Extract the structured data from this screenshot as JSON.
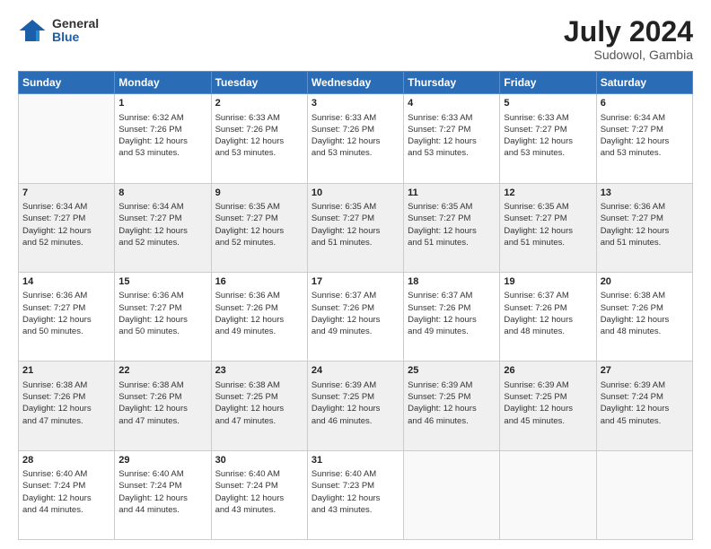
{
  "header": {
    "logo_general": "General",
    "logo_blue": "Blue",
    "month_year": "July 2024",
    "location": "Sudowol, Gambia"
  },
  "days_of_week": [
    "Sunday",
    "Monday",
    "Tuesday",
    "Wednesday",
    "Thursday",
    "Friday",
    "Saturday"
  ],
  "weeks": [
    [
      {
        "day": "",
        "content": ""
      },
      {
        "day": "1",
        "sunrise": "6:32 AM",
        "sunset": "7:26 PM",
        "daylight": "12 hours and 53 minutes."
      },
      {
        "day": "2",
        "sunrise": "6:33 AM",
        "sunset": "7:26 PM",
        "daylight": "12 hours and 53 minutes."
      },
      {
        "day": "3",
        "sunrise": "6:33 AM",
        "sunset": "7:26 PM",
        "daylight": "12 hours and 53 minutes."
      },
      {
        "day": "4",
        "sunrise": "6:33 AM",
        "sunset": "7:27 PM",
        "daylight": "12 hours and 53 minutes."
      },
      {
        "day": "5",
        "sunrise": "6:33 AM",
        "sunset": "7:27 PM",
        "daylight": "12 hours and 53 minutes."
      },
      {
        "day": "6",
        "sunrise": "6:34 AM",
        "sunset": "7:27 PM",
        "daylight": "12 hours and 53 minutes."
      }
    ],
    [
      {
        "day": "7",
        "sunrise": "6:34 AM",
        "sunset": "7:27 PM",
        "daylight": "12 hours and 52 minutes."
      },
      {
        "day": "8",
        "sunrise": "6:34 AM",
        "sunset": "7:27 PM",
        "daylight": "12 hours and 52 minutes."
      },
      {
        "day": "9",
        "sunrise": "6:35 AM",
        "sunset": "7:27 PM",
        "daylight": "12 hours and 52 minutes."
      },
      {
        "day": "10",
        "sunrise": "6:35 AM",
        "sunset": "7:27 PM",
        "daylight": "12 hours and 51 minutes."
      },
      {
        "day": "11",
        "sunrise": "6:35 AM",
        "sunset": "7:27 PM",
        "daylight": "12 hours and 51 minutes."
      },
      {
        "day": "12",
        "sunrise": "6:35 AM",
        "sunset": "7:27 PM",
        "daylight": "12 hours and 51 minutes."
      },
      {
        "day": "13",
        "sunrise": "6:36 AM",
        "sunset": "7:27 PM",
        "daylight": "12 hours and 51 minutes."
      }
    ],
    [
      {
        "day": "14",
        "sunrise": "6:36 AM",
        "sunset": "7:27 PM",
        "daylight": "12 hours and 50 minutes."
      },
      {
        "day": "15",
        "sunrise": "6:36 AM",
        "sunset": "7:27 PM",
        "daylight": "12 hours and 50 minutes."
      },
      {
        "day": "16",
        "sunrise": "6:36 AM",
        "sunset": "7:26 PM",
        "daylight": "12 hours and 49 minutes."
      },
      {
        "day": "17",
        "sunrise": "6:37 AM",
        "sunset": "7:26 PM",
        "daylight": "12 hours and 49 minutes."
      },
      {
        "day": "18",
        "sunrise": "6:37 AM",
        "sunset": "7:26 PM",
        "daylight": "12 hours and 49 minutes."
      },
      {
        "day": "19",
        "sunrise": "6:37 AM",
        "sunset": "7:26 PM",
        "daylight": "12 hours and 48 minutes."
      },
      {
        "day": "20",
        "sunrise": "6:38 AM",
        "sunset": "7:26 PM",
        "daylight": "12 hours and 48 minutes."
      }
    ],
    [
      {
        "day": "21",
        "sunrise": "6:38 AM",
        "sunset": "7:26 PM",
        "daylight": "12 hours and 47 minutes."
      },
      {
        "day": "22",
        "sunrise": "6:38 AM",
        "sunset": "7:26 PM",
        "daylight": "12 hours and 47 minutes."
      },
      {
        "day": "23",
        "sunrise": "6:38 AM",
        "sunset": "7:25 PM",
        "daylight": "12 hours and 47 minutes."
      },
      {
        "day": "24",
        "sunrise": "6:39 AM",
        "sunset": "7:25 PM",
        "daylight": "12 hours and 46 minutes."
      },
      {
        "day": "25",
        "sunrise": "6:39 AM",
        "sunset": "7:25 PM",
        "daylight": "12 hours and 46 minutes."
      },
      {
        "day": "26",
        "sunrise": "6:39 AM",
        "sunset": "7:25 PM",
        "daylight": "12 hours and 45 minutes."
      },
      {
        "day": "27",
        "sunrise": "6:39 AM",
        "sunset": "7:24 PM",
        "daylight": "12 hours and 45 minutes."
      }
    ],
    [
      {
        "day": "28",
        "sunrise": "6:40 AM",
        "sunset": "7:24 PM",
        "daylight": "12 hours and 44 minutes."
      },
      {
        "day": "29",
        "sunrise": "6:40 AM",
        "sunset": "7:24 PM",
        "daylight": "12 hours and 44 minutes."
      },
      {
        "day": "30",
        "sunrise": "6:40 AM",
        "sunset": "7:24 PM",
        "daylight": "12 hours and 43 minutes."
      },
      {
        "day": "31",
        "sunrise": "6:40 AM",
        "sunset": "7:23 PM",
        "daylight": "12 hours and 43 minutes."
      },
      {
        "day": "",
        "content": ""
      },
      {
        "day": "",
        "content": ""
      },
      {
        "day": "",
        "content": ""
      }
    ]
  ]
}
